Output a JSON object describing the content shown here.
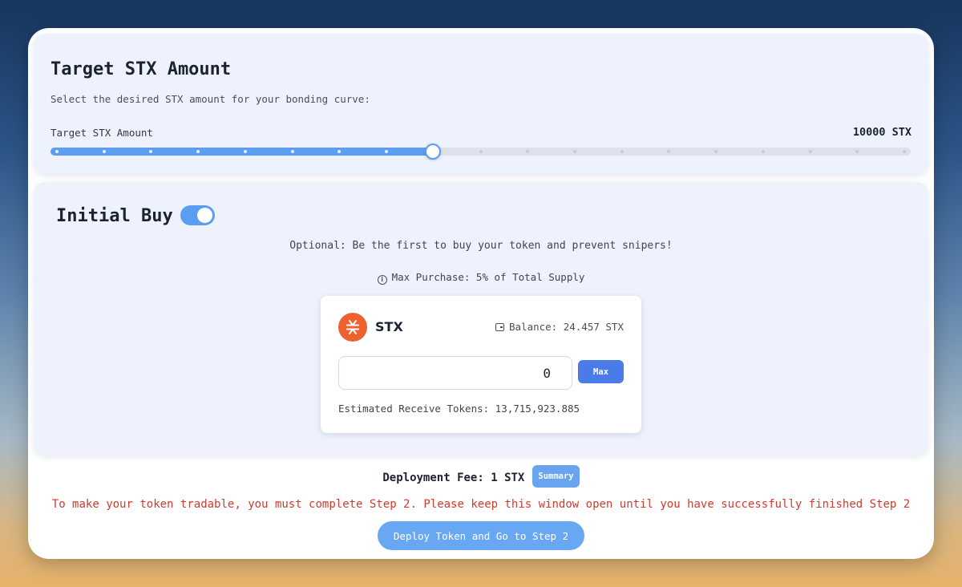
{
  "target_section": {
    "title": "Target STX Amount",
    "subtitle": "Select the desired STX amount for your bonding curve:",
    "slider_label": "Target STX Amount",
    "slider_value": "10000 STX",
    "slider_fraction": 0.445
  },
  "initial_buy": {
    "title": "Initial Buy",
    "toggle_on": true,
    "optional_text": "Optional: Be the first to buy your token and prevent snipers!",
    "max_purchase_text": "Max Purchase: 5% of Total Supply",
    "token_symbol": "STX",
    "balance_text": "Balance: 24.457 STX",
    "amount_value": "0",
    "max_label": "Max",
    "estimate_text": "Estimated Receive Tokens: 13,715,923.885"
  },
  "footer": {
    "fee_text": "Deployment Fee: 1 STX",
    "summary_label": "Summary",
    "warning_text": "To make your token tradable, you must complete Step 2. Please keep this window open until you have successfully finished Step 2",
    "deploy_label": "Deploy Token and Go to Step 2"
  },
  "colors": {
    "accent": "#5b9ef1",
    "button": "#4a7be8",
    "warning": "#d23a2c",
    "stx_logo": "#ee6231"
  },
  "icons": {
    "info": "info-icon",
    "wallet": "wallet-icon",
    "token": "stx-logo-icon"
  }
}
